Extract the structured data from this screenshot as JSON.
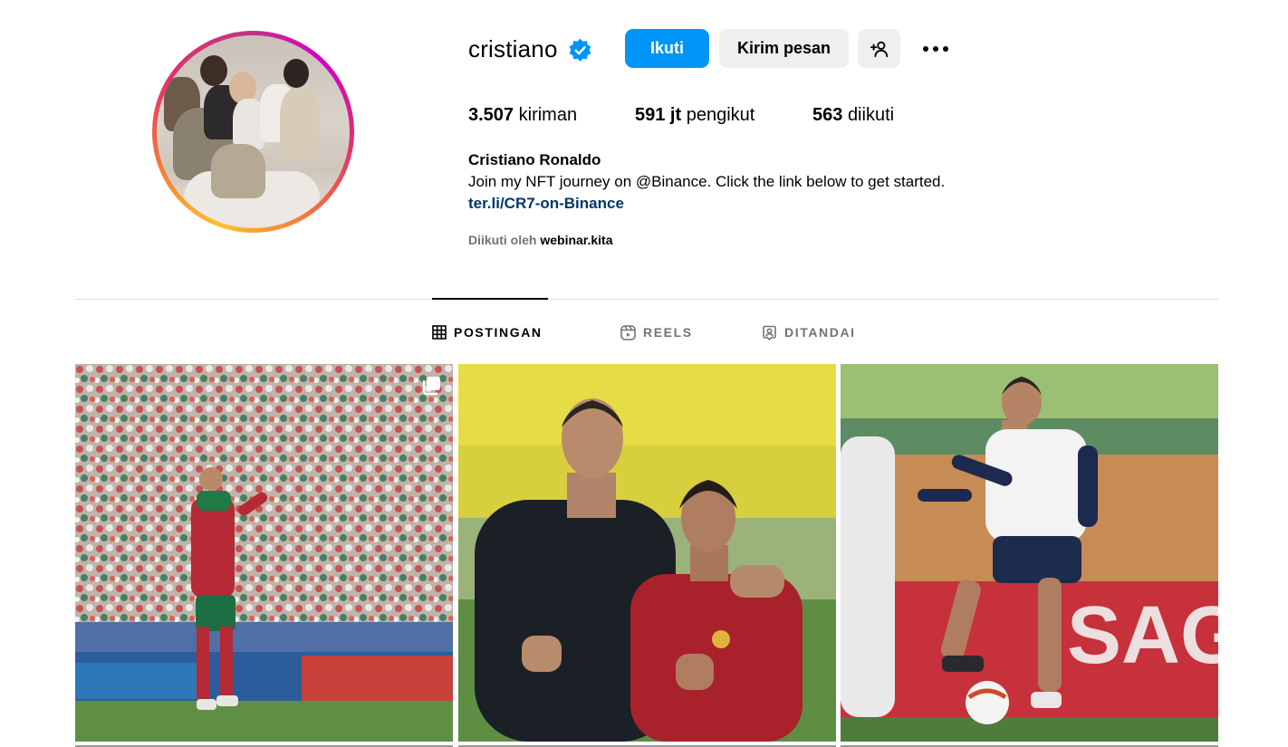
{
  "profile": {
    "username": "cristiano",
    "verified": true,
    "full_name": "Cristiano Ronaldo",
    "bio": "Join my NFT journey on @Binance. Click the link below to get started.",
    "link": "ter.li/CR7-on-Binance",
    "followed_by_label": "Diikuti oleh",
    "followed_by_user": "webinar.kita",
    "avatar_description": "family-photo"
  },
  "actions": {
    "follow_label": "Ikuti",
    "message_label": "Kirim pesan",
    "add_user_icon": "person-plus-icon",
    "more_icon": "ellipsis-icon"
  },
  "stats": {
    "posts_count": "3.507",
    "posts_label": "kiriman",
    "followers_count": "591 jt",
    "followers_label": "pengikut",
    "following_count": "563",
    "following_label": "diikuti"
  },
  "tabs": [
    {
      "label": "POSTINGAN",
      "icon": "grid-icon",
      "active": true
    },
    {
      "label": "REELS",
      "icon": "reels-icon",
      "active": false
    },
    {
      "label": "DITANDAI",
      "icon": "tagged-icon",
      "active": false
    }
  ],
  "posts": [
    {
      "type": "carousel",
      "icon": "carousel-icon"
    },
    {
      "type": "photo"
    },
    {
      "type": "photo"
    }
  ],
  "colors": {
    "primary_button": "#0095f6",
    "secondary_button": "#efefef",
    "link": "#00376b",
    "muted_text": "#737373",
    "divider": "#dbdbdb",
    "verified_badge": "#0095f6"
  }
}
